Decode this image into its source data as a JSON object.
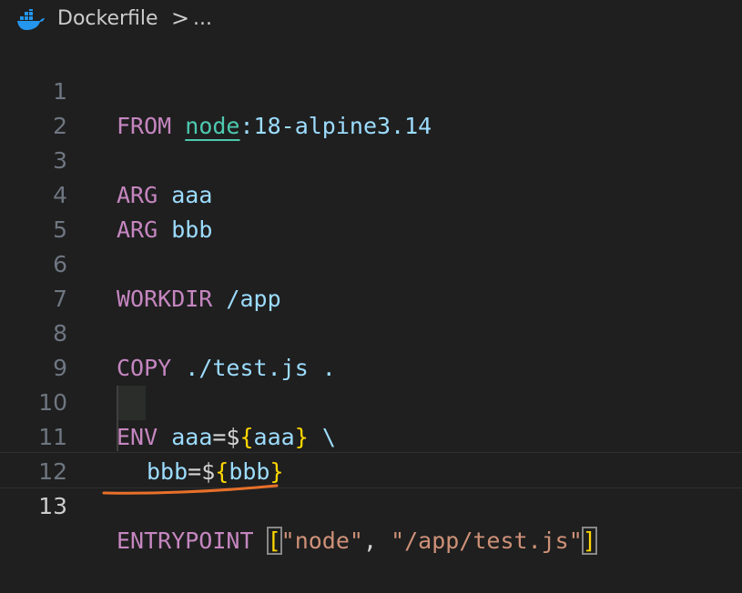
{
  "breadcrumb": {
    "file": "Dockerfile",
    "separator": ">",
    "ellipsis": "..."
  },
  "icons": {
    "file_icon": "docker-icon"
  },
  "colors": {
    "keyword": "#c586c0",
    "string": "#ce9178",
    "variable": "#9cdcfe",
    "brace": "#ffd700",
    "annotation": "#e8702a"
  },
  "editor": {
    "active_line": 13,
    "lines": [
      {
        "n": "1"
      },
      {
        "n": "2"
      },
      {
        "n": "3"
      },
      {
        "n": "4"
      },
      {
        "n": "5"
      },
      {
        "n": "6"
      },
      {
        "n": "7"
      },
      {
        "n": "8"
      },
      {
        "n": "9"
      },
      {
        "n": "10"
      },
      {
        "n": "11"
      },
      {
        "n": "12"
      },
      {
        "n": "13"
      }
    ],
    "tokens": {
      "l1_kw": "FROM",
      "l1_img": "node",
      "l1_tag": ":18-alpine3.14",
      "l3_kw": "ARG",
      "l3_arg": "aaa",
      "l4_kw": "ARG",
      "l4_arg": "bbb",
      "l6_kw": "WORKDIR",
      "l6_path": "/app",
      "l8_kw": "COPY",
      "l8_args": "./test.js .",
      "l10_kw": "ENV",
      "l10_name": "aaa",
      "l10_eq": "=$",
      "l10_open": "{",
      "l10_ref": "aaa",
      "l10_close": "}",
      "l10_cont": "\\",
      "l11_name": "bbb",
      "l11_eq": "=$",
      "l11_open": "{",
      "l11_ref": "bbb",
      "l11_close": "}",
      "l13_kw": "ENTRYPOINT",
      "l13_open": "[",
      "l13_s1": "\"node\"",
      "l13_comma": ", ",
      "l13_s2": "\"/app/test.js\"",
      "l13_close": "]"
    }
  }
}
